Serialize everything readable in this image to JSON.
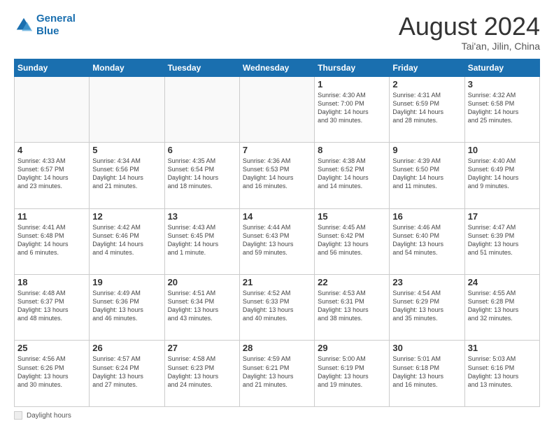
{
  "logo": {
    "line1": "General",
    "line2": "Blue"
  },
  "header": {
    "month_year": "August 2024",
    "location": "Tai'an, Jilin, China"
  },
  "days_of_week": [
    "Sunday",
    "Monday",
    "Tuesday",
    "Wednesday",
    "Thursday",
    "Friday",
    "Saturday"
  ],
  "weeks": [
    [
      {
        "day": "",
        "info": ""
      },
      {
        "day": "",
        "info": ""
      },
      {
        "day": "",
        "info": ""
      },
      {
        "day": "",
        "info": ""
      },
      {
        "day": "1",
        "info": "Sunrise: 4:30 AM\nSunset: 7:00 PM\nDaylight: 14 hours\nand 30 minutes."
      },
      {
        "day": "2",
        "info": "Sunrise: 4:31 AM\nSunset: 6:59 PM\nDaylight: 14 hours\nand 28 minutes."
      },
      {
        "day": "3",
        "info": "Sunrise: 4:32 AM\nSunset: 6:58 PM\nDaylight: 14 hours\nand 25 minutes."
      }
    ],
    [
      {
        "day": "4",
        "info": "Sunrise: 4:33 AM\nSunset: 6:57 PM\nDaylight: 14 hours\nand 23 minutes."
      },
      {
        "day": "5",
        "info": "Sunrise: 4:34 AM\nSunset: 6:56 PM\nDaylight: 14 hours\nand 21 minutes."
      },
      {
        "day": "6",
        "info": "Sunrise: 4:35 AM\nSunset: 6:54 PM\nDaylight: 14 hours\nand 18 minutes."
      },
      {
        "day": "7",
        "info": "Sunrise: 4:36 AM\nSunset: 6:53 PM\nDaylight: 14 hours\nand 16 minutes."
      },
      {
        "day": "8",
        "info": "Sunrise: 4:38 AM\nSunset: 6:52 PM\nDaylight: 14 hours\nand 14 minutes."
      },
      {
        "day": "9",
        "info": "Sunrise: 4:39 AM\nSunset: 6:50 PM\nDaylight: 14 hours\nand 11 minutes."
      },
      {
        "day": "10",
        "info": "Sunrise: 4:40 AM\nSunset: 6:49 PM\nDaylight: 14 hours\nand 9 minutes."
      }
    ],
    [
      {
        "day": "11",
        "info": "Sunrise: 4:41 AM\nSunset: 6:48 PM\nDaylight: 14 hours\nand 6 minutes."
      },
      {
        "day": "12",
        "info": "Sunrise: 4:42 AM\nSunset: 6:46 PM\nDaylight: 14 hours\nand 4 minutes."
      },
      {
        "day": "13",
        "info": "Sunrise: 4:43 AM\nSunset: 6:45 PM\nDaylight: 14 hours\nand 1 minute."
      },
      {
        "day": "14",
        "info": "Sunrise: 4:44 AM\nSunset: 6:43 PM\nDaylight: 13 hours\nand 59 minutes."
      },
      {
        "day": "15",
        "info": "Sunrise: 4:45 AM\nSunset: 6:42 PM\nDaylight: 13 hours\nand 56 minutes."
      },
      {
        "day": "16",
        "info": "Sunrise: 4:46 AM\nSunset: 6:40 PM\nDaylight: 13 hours\nand 54 minutes."
      },
      {
        "day": "17",
        "info": "Sunrise: 4:47 AM\nSunset: 6:39 PM\nDaylight: 13 hours\nand 51 minutes."
      }
    ],
    [
      {
        "day": "18",
        "info": "Sunrise: 4:48 AM\nSunset: 6:37 PM\nDaylight: 13 hours\nand 48 minutes."
      },
      {
        "day": "19",
        "info": "Sunrise: 4:49 AM\nSunset: 6:36 PM\nDaylight: 13 hours\nand 46 minutes."
      },
      {
        "day": "20",
        "info": "Sunrise: 4:51 AM\nSunset: 6:34 PM\nDaylight: 13 hours\nand 43 minutes."
      },
      {
        "day": "21",
        "info": "Sunrise: 4:52 AM\nSunset: 6:33 PM\nDaylight: 13 hours\nand 40 minutes."
      },
      {
        "day": "22",
        "info": "Sunrise: 4:53 AM\nSunset: 6:31 PM\nDaylight: 13 hours\nand 38 minutes."
      },
      {
        "day": "23",
        "info": "Sunrise: 4:54 AM\nSunset: 6:29 PM\nDaylight: 13 hours\nand 35 minutes."
      },
      {
        "day": "24",
        "info": "Sunrise: 4:55 AM\nSunset: 6:28 PM\nDaylight: 13 hours\nand 32 minutes."
      }
    ],
    [
      {
        "day": "25",
        "info": "Sunrise: 4:56 AM\nSunset: 6:26 PM\nDaylight: 13 hours\nand 30 minutes."
      },
      {
        "day": "26",
        "info": "Sunrise: 4:57 AM\nSunset: 6:24 PM\nDaylight: 13 hours\nand 27 minutes."
      },
      {
        "day": "27",
        "info": "Sunrise: 4:58 AM\nSunset: 6:23 PM\nDaylight: 13 hours\nand 24 minutes."
      },
      {
        "day": "28",
        "info": "Sunrise: 4:59 AM\nSunset: 6:21 PM\nDaylight: 13 hours\nand 21 minutes."
      },
      {
        "day": "29",
        "info": "Sunrise: 5:00 AM\nSunset: 6:19 PM\nDaylight: 13 hours\nand 19 minutes."
      },
      {
        "day": "30",
        "info": "Sunrise: 5:01 AM\nSunset: 6:18 PM\nDaylight: 13 hours\nand 16 minutes."
      },
      {
        "day": "31",
        "info": "Sunrise: 5:03 AM\nSunset: 6:16 PM\nDaylight: 13 hours\nand 13 minutes."
      }
    ]
  ],
  "footer": {
    "label": "Daylight hours"
  }
}
